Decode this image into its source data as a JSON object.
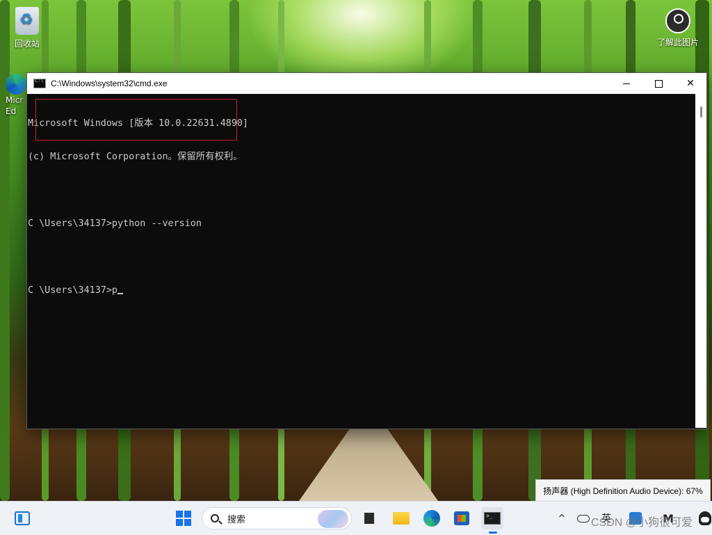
{
  "desktop": {
    "icons": {
      "recycle_bin": "回收站",
      "learn_about_picture": "了解此图片",
      "edge_partial": "Micr\nEd"
    }
  },
  "cmd_window": {
    "title": "C:\\Windows\\system32\\cmd.exe",
    "controls": {
      "minimize": "minimize",
      "maximize": "maximize",
      "close": "✕"
    },
    "console_lines": [
      "Microsoft Windows [版本 10.0.22631.4890]",
      "(c) Microsoft Corporation。保留所有权利。",
      "",
      "C \\Users\\34137>python --version",
      "",
      "C \\Users\\34137>p"
    ]
  },
  "volume_flyout": {
    "text": "扬声器 (High Definition Audio Device): 67%"
  },
  "taskbar": {
    "search_placeholder": "搜索",
    "tray": {
      "chevron": "^",
      "language": "英",
      "m_label": "M"
    }
  },
  "watermark": "CSDN @小狗很可爱",
  "colors": {
    "console_bg": "#0c0c0c",
    "console_text": "#cccccc",
    "highlight_border": "#c0213a",
    "taskbar_bg": "#eef1f6",
    "accent": "#1a73e8"
  }
}
